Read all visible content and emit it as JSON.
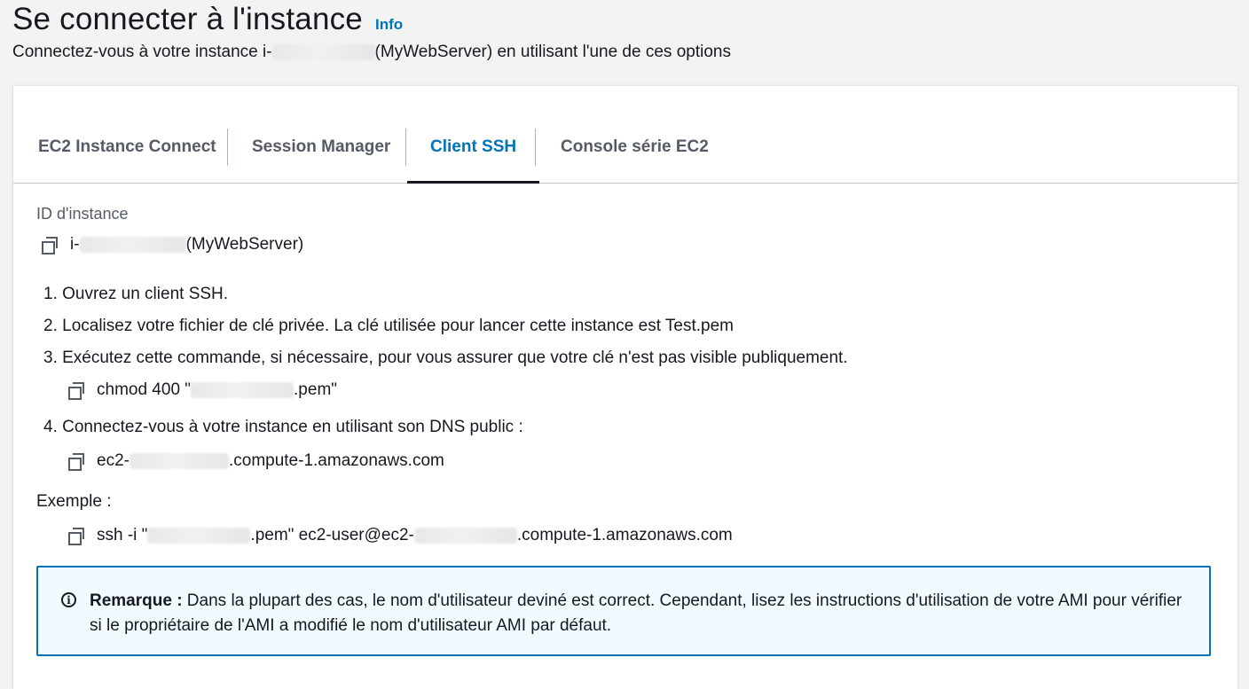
{
  "header": {
    "title": "Se connecter à l'instance",
    "info_label": "Info",
    "subtitle_before": "Connectez-vous à votre instance i-",
    "subtitle_after": " (MyWebServer) en utilisant l'une de ces options"
  },
  "tabs": [
    {
      "label": "EC2 Instance Connect",
      "active": false
    },
    {
      "label": "Session Manager",
      "active": false
    },
    {
      "label": "Client SSH",
      "active": true
    },
    {
      "label": "Console série EC2",
      "active": false
    }
  ],
  "instance": {
    "label": "ID d'instance",
    "prefix": "i-",
    "suffix": " (MyWebServer)"
  },
  "steps": [
    {
      "text": "1. Ouvrez un client SSH."
    },
    {
      "text": "2. Localisez votre fichier de clé privée. La clé utilisée pour lancer cette instance est Test.pem"
    },
    {
      "text": "3. Exécutez cette commande, si nécessaire, pour vous assurer que votre clé n'est pas visible publiquement."
    },
    {
      "text": "4. Connectez-vous à votre instance en utilisant son DNS public :"
    }
  ],
  "commands": {
    "chmod_before": "chmod 400 \"",
    "chmod_after": ".pem\"",
    "dns_before": "ec2-",
    "dns_after": ".compute-1.amazonaws.com"
  },
  "example": {
    "label": "Exemple :",
    "part1": "ssh -i \"",
    "part2": ".pem\" ec2-user@ec2-",
    "part3": ".compute-1.amazonaws.com"
  },
  "note": {
    "bold": "Remarque :",
    "text": " Dans la plupart des cas, le nom d'utilisateur deviné est correct. Cependant, lisez les instructions d'utilisation de votre AMI pour vérifier si le propriétaire de l'AMI a modifié le nom d'utilisateur AMI par défaut."
  },
  "colors": {
    "accent": "#0073bb",
    "note_background": "#f1faff",
    "page_background": "#f2f3f3"
  }
}
